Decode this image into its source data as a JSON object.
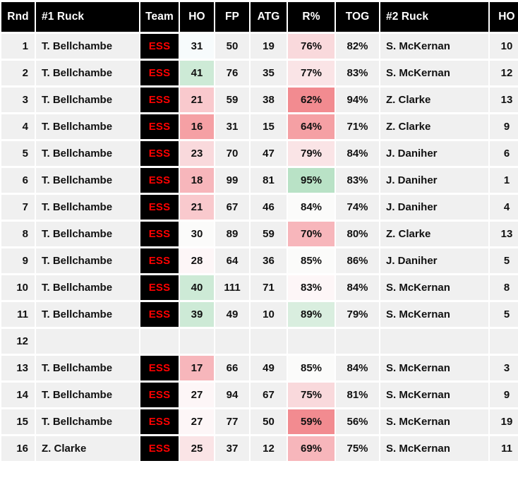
{
  "table": {
    "columns": [
      {
        "key": "rnd",
        "label": "Rnd"
      },
      {
        "key": "ruck1",
        "label": "#1 Ruck"
      },
      {
        "key": "team",
        "label": "Team"
      },
      {
        "key": "ho1",
        "label": "HO"
      },
      {
        "key": "fp",
        "label": "FP"
      },
      {
        "key": "atg",
        "label": "ATG"
      },
      {
        "key": "rpct",
        "label": "R%"
      },
      {
        "key": "tog",
        "label": "TOG"
      },
      {
        "key": "ruck2",
        "label": "#2 Ruck"
      },
      {
        "key": "ho2",
        "label": "HO"
      }
    ],
    "rows": [
      {
        "rnd": "1",
        "ruck1": "T. Bellchambe",
        "team": "ESS",
        "ho1": "31",
        "ho1_heat": "wb",
        "fp": "50",
        "atg": "19",
        "rpct": "76%",
        "rpct_heat": "r2",
        "tog": "82%",
        "ruck2": "S. McKernan",
        "ho2": "10"
      },
      {
        "rnd": "2",
        "ruck1": "T. Bellchambe",
        "team": "ESS",
        "ho1": "41",
        "ho1_heat": "g2",
        "fp": "76",
        "atg": "35",
        "rpct": "77%",
        "rpct_heat": "r1",
        "tog": "83%",
        "ruck2": "S. McKernan",
        "ho2": "12"
      },
      {
        "rnd": "3",
        "ruck1": "T. Bellchambe",
        "team": "ESS",
        "ho1": "21",
        "ho1_heat": "r3",
        "fp": "59",
        "atg": "38",
        "rpct": "62%",
        "rpct_heat": "r6",
        "tog": "94%",
        "ruck2": "Z. Clarke",
        "ho2": "13"
      },
      {
        "rnd": "4",
        "ruck1": "T. Bellchambe",
        "team": "ESS",
        "ho1": "16",
        "ho1_heat": "r5",
        "fp": "31",
        "atg": "15",
        "rpct": "64%",
        "rpct_heat": "r5",
        "tog": "71%",
        "ruck2": "Z. Clarke",
        "ho2": "9"
      },
      {
        "rnd": "5",
        "ruck1": "T. Bellchambe",
        "team": "ESS",
        "ho1": "23",
        "ho1_heat": "r2",
        "fp": "70",
        "atg": "47",
        "rpct": "79%",
        "rpct_heat": "r1",
        "tog": "84%",
        "ruck2": "J. Daniher",
        "ho2": "6"
      },
      {
        "rnd": "6",
        "ruck1": "T. Bellchambe",
        "team": "ESS",
        "ho1": "18",
        "ho1_heat": "r4",
        "fp": "99",
        "atg": "81",
        "rpct": "95%",
        "rpct_heat": "g3",
        "tog": "83%",
        "ruck2": "J. Daniher",
        "ho2": "1"
      },
      {
        "rnd": "7",
        "ruck1": "T. Bellchambe",
        "team": "ESS",
        "ho1": "21",
        "ho1_heat": "r3",
        "fp": "67",
        "atg": "46",
        "rpct": "84%",
        "rpct_heat": "w0",
        "tog": "74%",
        "ruck2": "J. Daniher",
        "ho2": "4"
      },
      {
        "rnd": "8",
        "ruck1": "T. Bellchambe",
        "team": "ESS",
        "ho1": "30",
        "ho1_heat": "w0",
        "fp": "89",
        "atg": "59",
        "rpct": "70%",
        "rpct_heat": "r4",
        "tog": "80%",
        "ruck2": "Z. Clarke",
        "ho2": "13"
      },
      {
        "rnd": "9",
        "ruck1": "T. Bellchambe",
        "team": "ESS",
        "ho1": "28",
        "ho1_heat": "wp",
        "fp": "64",
        "atg": "36",
        "rpct": "85%",
        "rpct_heat": "w0",
        "tog": "86%",
        "ruck2": "J. Daniher",
        "ho2": "5"
      },
      {
        "rnd": "10",
        "ruck1": "T. Bellchambe",
        "team": "ESS",
        "ho1": "40",
        "ho1_heat": "g2",
        "fp": "111",
        "atg": "71",
        "rpct": "83%",
        "rpct_heat": "wp",
        "tog": "84%",
        "ruck2": "S. McKernan",
        "ho2": "8"
      },
      {
        "rnd": "11",
        "ruck1": "T. Bellchambe",
        "team": "ESS",
        "ho1": "39",
        "ho1_heat": "g2",
        "fp": "49",
        "atg": "10",
        "rpct": "89%",
        "rpct_heat": "g1",
        "tog": "79%",
        "ruck2": "S. McKernan",
        "ho2": "5"
      },
      {
        "rnd": "12",
        "ruck1": "",
        "team": "",
        "ho1": "",
        "ho1_heat": "n0",
        "fp": "",
        "atg": "",
        "rpct": "",
        "rpct_heat": "n0",
        "tog": "",
        "ruck2": "",
        "ho2": ""
      },
      {
        "rnd": "13",
        "ruck1": "T. Bellchambe",
        "team": "ESS",
        "ho1": "17",
        "ho1_heat": "r4",
        "fp": "66",
        "atg": "49",
        "rpct": "85%",
        "rpct_heat": "w0",
        "tog": "84%",
        "ruck2": "S. McKernan",
        "ho2": "3"
      },
      {
        "rnd": "14",
        "ruck1": "T. Bellchambe",
        "team": "ESS",
        "ho1": "27",
        "ho1_heat": "wp",
        "fp": "94",
        "atg": "67",
        "rpct": "75%",
        "rpct_heat": "r2",
        "tog": "81%",
        "ruck2": "S. McKernan",
        "ho2": "9"
      },
      {
        "rnd": "15",
        "ruck1": "T. Bellchambe",
        "team": "ESS",
        "ho1": "27",
        "ho1_heat": "wp",
        "fp": "77",
        "atg": "50",
        "rpct": "59%",
        "rpct_heat": "r6",
        "tog": "56%",
        "ruck2": "S. McKernan",
        "ho2": "19"
      },
      {
        "rnd": "16",
        "ruck1": "Z. Clarke",
        "team": "ESS",
        "ho1": "25",
        "ho1_heat": "r1",
        "fp": "37",
        "atg": "12",
        "rpct": "69%",
        "rpct_heat": "r4",
        "tog": "75%",
        "ruck2": "S. McKernan",
        "ho2": "11"
      }
    ]
  },
  "colors": {
    "header_bg": "#000000",
    "header_text": "#ffffff",
    "cell_bg": "#f0f0f0",
    "team_badge_bg": "#000000",
    "team_badge_text": "#ff0000",
    "heat_green_high": "#b9e2c6",
    "heat_red_high": "#f28b90"
  }
}
